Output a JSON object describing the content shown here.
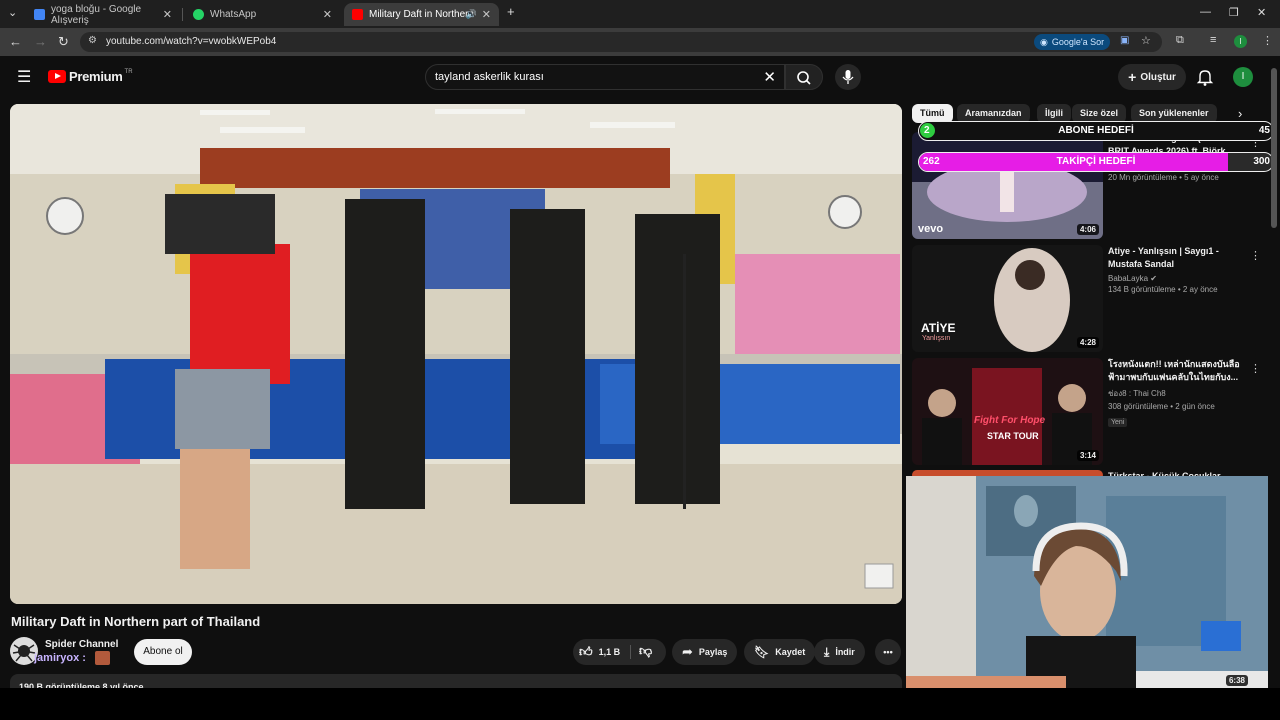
{
  "browser": {
    "tabs": [
      {
        "title": "yoga bloğu - Google Alışveriş",
        "active": false
      },
      {
        "title": "WhatsApp",
        "active": false
      },
      {
        "title": "Military Daft in Northern pa",
        "active": true
      }
    ],
    "url": "youtube.com/watch?v=vwobkWEPob4",
    "google_sor": "Google'a Sor",
    "profile_initial": "I"
  },
  "header": {
    "brand": "Premium",
    "region": "TR",
    "search_query": "tayland askerlik kurası",
    "create_label": "Oluştur",
    "avatar_initial": "I"
  },
  "video": {
    "title": "Military Daft in Northern part of Thailand",
    "channel": "Spider Channel",
    "streamer_overlay": "jamiryox :",
    "subscribe": "Abone ol",
    "likes": "1,1 B",
    "share": "Paylaş",
    "save": "Kaydet",
    "download": "İndir",
    "description_preview": "190 B görüntüleme  8 yıl önce"
  },
  "chips": [
    "Tümü",
    "Aramanızdan",
    "İlgili",
    "Size özel",
    "Son yüklenenler"
  ],
  "goals": {
    "abone": {
      "label": "ABONE HEDEFİ",
      "current": "2",
      "target": "45"
    },
    "takipci": {
      "label": "TAKİPÇİ HEDEFİ",
      "current": "262",
      "target": "300"
    }
  },
  "recommendations": [
    {
      "title": "ROSALÍA - Berghain (Live at The BRIT Awards 2026) ft. Björk",
      "channel": "",
      "meta": "20 Mn görüntüleme • 5 ay önce",
      "duration": "4:06",
      "badge": ""
    },
    {
      "title": "Atiye - Yanlışsın | Saygı1 - Mustafa Sandal",
      "channel": "BabaLayka",
      "meta": "134 B görüntüleme • 2 ay önce",
      "duration": "4:28",
      "badge": ""
    },
    {
      "title": "โรงหนังแตก!! เหล่านักแสดงบันลือฟ้ามาพบกับแฟนคลับในไทยกับง...",
      "channel": "ช่อง8 : Thai Ch8",
      "meta": "308 görüntüleme • 2 gün önce",
      "duration": "3:14",
      "badge": "Yeni"
    },
    {
      "title": "Türkstar - Küçük Çocuklar",
      "channel": "",
      "meta": "",
      "duration": "",
      "badge": ""
    }
  ],
  "webcam_duration": "6:38",
  "thumbnail_text": {
    "atiye": "ATİYE",
    "atiye_sub": "Yanlışsın",
    "vevo": "vevo",
    "fight": "Fight For Hope",
    "star_tour": "STAR TOUR"
  }
}
